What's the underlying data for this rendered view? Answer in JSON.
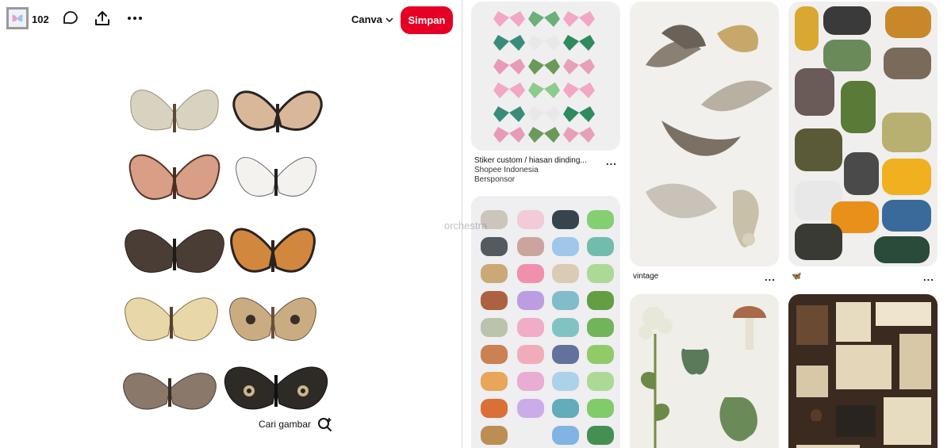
{
  "pin": {
    "save_count": "102",
    "board_name": "Canva",
    "save_label": "Simpan",
    "visual_search_label": "Cari gambar"
  },
  "feed": {
    "card1": {
      "title": "Stiker custom / hiasan dinding...",
      "source": "Shopee Indonesia",
      "sponsored": "Bersponsor"
    },
    "card3": {
      "title": "vintage"
    },
    "card5": {
      "title": "🦋"
    },
    "more": "..."
  },
  "overlay": {
    "watermark": "orchestra"
  },
  "colors": {
    "accent": "#e60023"
  }
}
